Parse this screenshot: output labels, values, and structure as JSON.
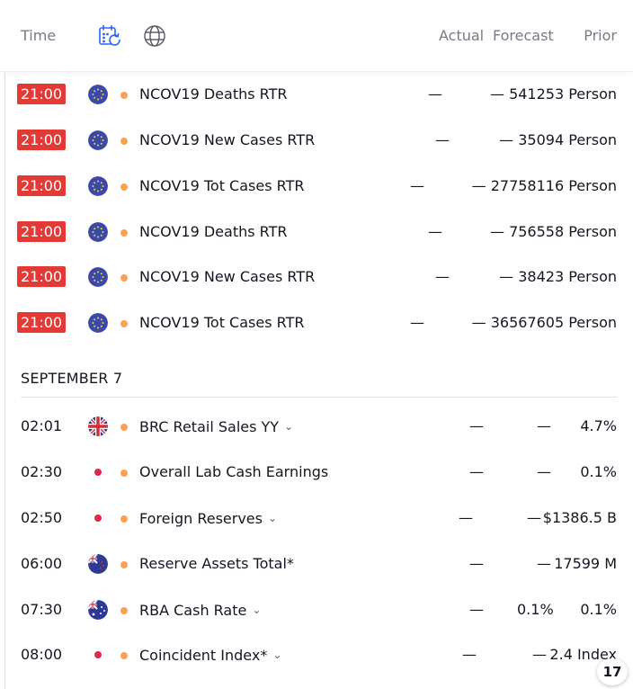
{
  "header": {
    "time_label": "Time",
    "actual_label": "Actual",
    "forecast_label": "Forecast",
    "prior_label": "Prior",
    "calendar_icon": "calendar-refresh-icon",
    "globe_icon": "globe-icon"
  },
  "rows_today": [
    {
      "time": "21:00",
      "title": "NCOV19 Deaths RTR",
      "actual": "—",
      "forecast": "—",
      "prior": "541253 Person",
      "flag": "eu"
    },
    {
      "time": "21:00",
      "title": "NCOV19 New Cases RTR",
      "actual": "—",
      "forecast": "—",
      "prior": "35094 Person",
      "flag": "eu"
    },
    {
      "time": "21:00",
      "title": "NCOV19 Tot Cases RTR",
      "actual": "—",
      "forecast": "—",
      "prior": "27758116 Person",
      "flag": "eu"
    },
    {
      "time": "21:00",
      "title": "NCOV19 Deaths RTR",
      "actual": "—",
      "forecast": "—",
      "prior": "756558 Person",
      "flag": "eu"
    },
    {
      "time": "21:00",
      "title": "NCOV19 New Cases RTR",
      "actual": "—",
      "forecast": "—",
      "prior": "38423 Person",
      "flag": "eu"
    },
    {
      "time": "21:00",
      "title": "NCOV19 Tot Cases RTR",
      "actual": "—",
      "forecast": "—",
      "prior": "36567605 Person",
      "flag": "eu"
    }
  ],
  "section_label": "SEPTEMBER 7",
  "rows_sep7": [
    {
      "time": "02:01",
      "title": "BRC Retail Sales YY",
      "actual": "—",
      "forecast": "—",
      "prior": "4.7%",
      "flag": "gb"
    },
    {
      "time": "02:30",
      "title": "Overall Lab Cash Earnings",
      "actual": "—",
      "forecast": "—",
      "prior": "0.1%",
      "flag": "jp"
    },
    {
      "time": "02:50",
      "title": "Foreign Reserves",
      "actual": "—",
      "forecast": "—",
      "prior": "$1386.5 B",
      "flag": "jp"
    },
    {
      "time": "06:00",
      "title": "Reserve Assets Total*",
      "actual": "—",
      "forecast": "—",
      "prior": "17599 M",
      "flag": "nz"
    },
    {
      "time": "07:30",
      "title": "RBA Cash Rate",
      "actual": "—",
      "forecast": "0.1%",
      "prior": "0.1%",
      "flag": "au"
    },
    {
      "time": "08:00",
      "title": "Coincident Index*",
      "actual": "—",
      "forecast": "—",
      "prior": "2.4 Index",
      "flag": "jp"
    }
  ],
  "logo_text": "17",
  "colors": {
    "live_badge": "#e53935",
    "importance_dot": "#f7a350",
    "muted_text": "#787b86"
  }
}
